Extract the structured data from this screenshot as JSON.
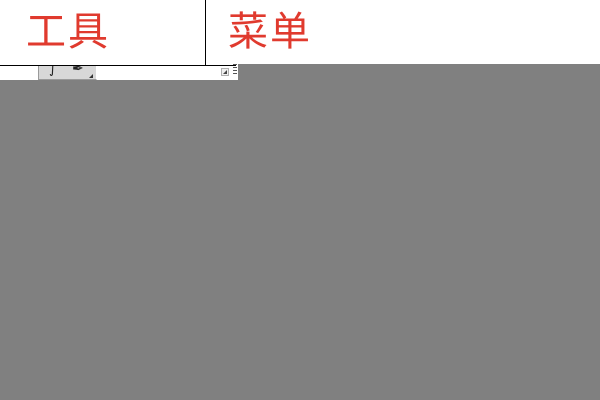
{
  "header": {
    "tools_label": "工具",
    "menu_label": "菜单"
  },
  "toolbar": {
    "icons": [
      "brush-icon",
      "pen-icon"
    ]
  },
  "colors": {
    "label_red": "#e03a2e",
    "canvas_gray": "#808080",
    "divider": "#000000"
  }
}
